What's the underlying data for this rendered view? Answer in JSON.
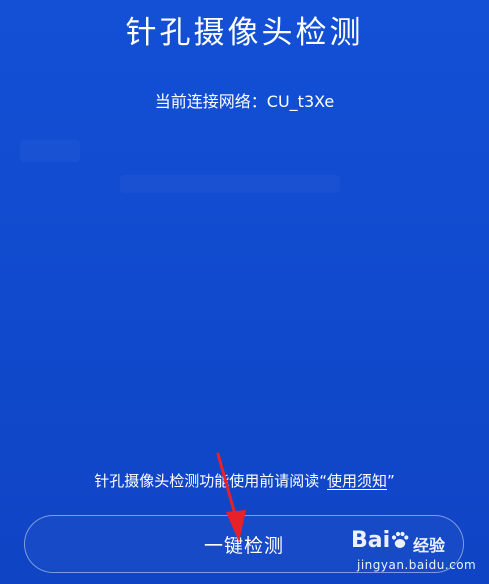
{
  "header": {
    "title": "针孔摄像头检测"
  },
  "network": {
    "text": "当前连接网络：CU_t3Xe"
  },
  "notice": {
    "prefix": "针孔摄像头检测功能使用前请阅读“",
    "link_label": "使用须知",
    "suffix": "”"
  },
  "actions": {
    "detect_label": "一键检测"
  },
  "annotation": {
    "arrow_color": "#e8202a"
  },
  "watermark": {
    "logo_left": "Bai",
    "logo_right": "",
    "tag": "经验",
    "url": "jingyan.baidu.com"
  },
  "colors": {
    "background": "#1248c9",
    "text": "#ffffff"
  }
}
